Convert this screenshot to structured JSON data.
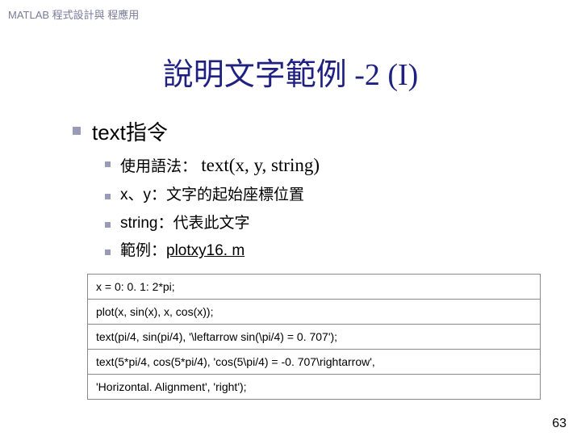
{
  "header": "MATLAB 程式設計與 程應用",
  "title": "說明文字範例 -2 (I)",
  "main_bullet": "text指令",
  "sub_bullets": [
    {
      "prefix": "使用語法：",
      "code": "text(x, y, string)"
    },
    {
      "text": "x、y：文字的起始座標位置"
    },
    {
      "text": "string：代表此文字"
    },
    {
      "prefix": "範例：",
      "link": "plotxy16. m"
    }
  ],
  "code": [
    "x = 0: 0. 1: 2*pi;",
    "plot(x, sin(x), x, cos(x));",
    "text(pi/4, sin(pi/4), '\\leftarrow sin(\\pi/4) = 0. 707');",
    "text(5*pi/4, cos(5*pi/4), 'cos(5\\pi/4) = -0. 707\\rightarrow',",
    "'Horizontal. Alignment', 'right');"
  ],
  "page_number": "63"
}
